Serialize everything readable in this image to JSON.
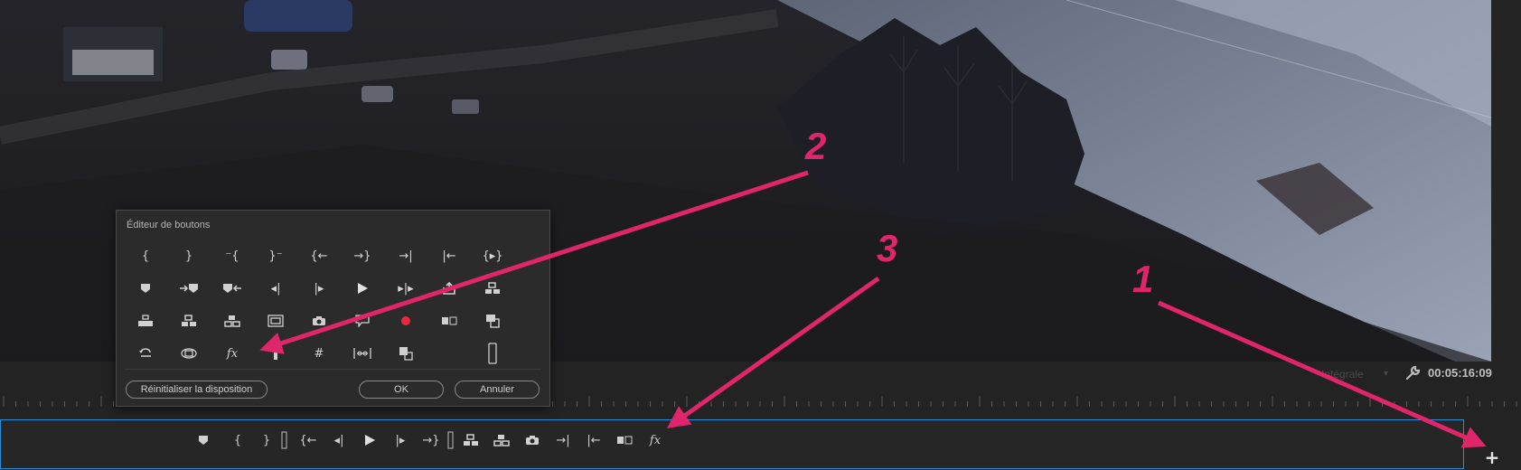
{
  "program_monitor": {
    "fit_label": "Intégrale",
    "timecode": "00:05:16:09"
  },
  "button_editor": {
    "title": "Éditeur de boutons",
    "reset_label": "Réinitialiser la disposition",
    "ok_label": "OK",
    "cancel_label": "Annuler",
    "fx_label": "fx"
  },
  "button_bar": {
    "fx_label": "fx",
    "add_label": "+"
  },
  "annotations": {
    "labels": [
      "1",
      "2",
      "3"
    ],
    "color": "#e0266a"
  },
  "colors": {
    "accent_border": "#2a8fd6",
    "record": "#e8283c",
    "panel": "#2b2b2b"
  }
}
